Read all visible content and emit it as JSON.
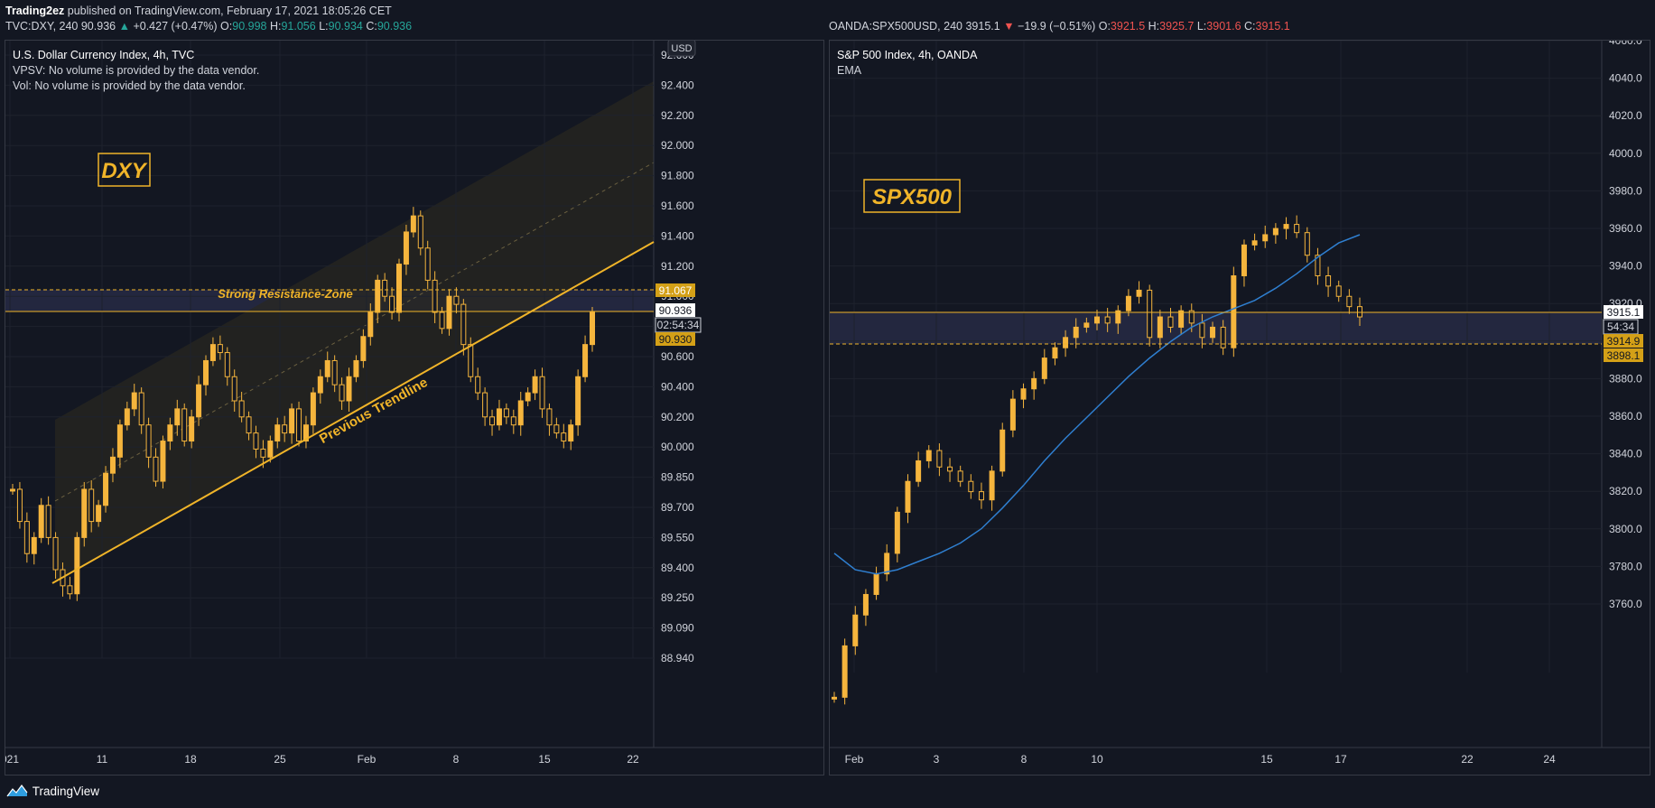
{
  "header": {
    "publisher": "Trading2ez",
    "published_text": "published on TradingView.com, February 17, 2021 18:05:26 CET",
    "left": {
      "symbol": "TVC:DXY, 240",
      "price": "90.936",
      "arrow": "▲",
      "change": "+0.427 (+0.47%)",
      "o_label": "O:",
      "o": "90.998",
      "h_label": "H:",
      "h": "91.056",
      "l_label": "L:",
      "l": "90.934",
      "c_label": "C:",
      "c": "90.936"
    },
    "right": {
      "symbol": "OANDA:SPX500USD, 240",
      "price": "3915.1",
      "arrow": "▼",
      "change": "−19.9 (−0.51%)",
      "o_label": "O:",
      "o": "3921.5",
      "h_label": "H:",
      "h": "3925.7",
      "l_label": "L:",
      "l": "3901.6",
      "c_label": "C:",
      "c": "3915.1"
    }
  },
  "left_panel": {
    "title": "U.S. Dollar Currency Index, 4h, TVC",
    "line2": "VPSV: No volume is provided by the data vendor.",
    "line3": "Vol: No volume is provided by the data vendor.",
    "currency_badge": "USD"
  },
  "right_panel": {
    "title": "S&P 500 Index, 4h, OANDA",
    "line2": "EMA"
  },
  "footer": {
    "brand": "TradingView"
  },
  "colors": {
    "background": "#131722",
    "candle": "#f5b53d",
    "annotation": "#f0b429",
    "ema": "#2f7fd0",
    "zone": "#2a2d4a",
    "grid": "#1e222d"
  },
  "chart_data": [
    {
      "type": "line",
      "title": "U.S. Dollar Currency Index, 4h, TVC",
      "label_box": "DXY",
      "ylim": [
        88.85,
        92.6
      ],
      "y_ticks": [
        "92.600",
        "92.400",
        "92.200",
        "92.000",
        "91.800",
        "91.600",
        "91.400",
        "91.200",
        "91.000",
        "90.800",
        "90.600",
        "90.400",
        "90.200",
        "90.000",
        "89.850",
        "89.700",
        "89.550",
        "89.400",
        "89.250",
        "89.090",
        "88.940"
      ],
      "x_ticks": [
        "021",
        "11",
        "18",
        "25",
        "Feb",
        "8",
        "15",
        "22"
      ],
      "grid": true,
      "annotations": {
        "zone_label": "Strong Resistance-Zone",
        "trend_label": "Previous Trendline"
      },
      "price_labels": {
        "high_zone": "91.067",
        "last_price": "90.936",
        "countdown": "02:54:34",
        "low_zone": "90.930"
      },
      "series": [
        {
          "values": [
            89.9,
            89.7,
            89.5,
            89.6,
            89.8,
            89.6,
            89.4,
            89.3,
            89.25,
            89.6,
            89.9,
            89.7,
            89.8,
            90.0,
            90.1,
            90.3,
            90.4,
            90.5,
            90.3,
            90.1,
            89.95,
            90.2,
            90.3,
            90.4,
            90.2,
            90.35,
            90.55,
            90.7,
            90.8,
            90.75,
            90.6,
            90.45,
            90.35,
            90.25,
            90.15,
            90.1,
            90.2,
            90.3,
            90.25,
            90.4,
            90.2,
            90.3,
            90.5,
            90.6,
            90.7,
            90.55,
            90.45,
            90.6,
            90.7,
            90.85,
            91.0,
            91.2,
            91.1,
            91.0,
            91.3,
            91.5,
            91.6,
            91.4,
            91.2,
            91.0,
            90.9,
            91.1,
            91.05,
            90.8,
            90.6,
            90.5,
            90.35,
            90.3,
            90.4,
            90.35,
            90.3,
            90.45,
            90.5,
            90.6,
            90.4,
            90.3,
            90.25,
            90.2,
            90.3,
            90.6,
            90.8,
            91.0
          ]
        }
      ]
    },
    {
      "type": "line",
      "title": "S&P 500 Index, 4h, OANDA",
      "label_box": "SPX500",
      "ylim": [
        3742,
        4045
      ],
      "y_ticks": [
        "4060.0",
        "4040.0",
        "4020.0",
        "4000.0",
        "3980.0",
        "3960.0",
        "3940.0",
        "3920.0",
        "3900.0",
        "3880.0",
        "3860.0",
        "3840.0",
        "3820.0",
        "3800.0",
        "3780.0",
        "3760.0"
      ],
      "x_ticks": [
        "Feb",
        "3",
        "8",
        "10",
        "15",
        "17",
        "22",
        "24"
      ],
      "grid": true,
      "price_labels": {
        "last_price": "3915.1",
        "countdown": "54:34",
        "zone_top": "3914.9",
        "zone_low": "3898.1"
      },
      "series": [
        {
          "values": [
            3730,
            3755,
            3770,
            3780,
            3790,
            3800,
            3820,
            3835,
            3845,
            3850,
            3842,
            3840,
            3835,
            3830,
            3826,
            3840,
            3860,
            3875,
            3880,
            3885,
            3895,
            3900,
            3905,
            3910,
            3912,
            3915,
            3912,
            3918,
            3925,
            3928,
            3905,
            3915,
            3910,
            3918,
            3912,
            3905,
            3910,
            3900,
            3935,
            3950,
            3952,
            3955,
            3958,
            3960,
            3956,
            3945,
            3935,
            3930,
            3925,
            3920,
            3915
          ]
        },
        {
          "name": "EMA",
          "values": [
            3800,
            3792,
            3790,
            3792,
            3796,
            3800,
            3805,
            3812,
            3822,
            3833,
            3845,
            3856,
            3866,
            3876,
            3886,
            3895,
            3903,
            3910,
            3915,
            3919,
            3923,
            3929,
            3936,
            3944,
            3951,
            3955
          ]
        }
      ]
    }
  ]
}
